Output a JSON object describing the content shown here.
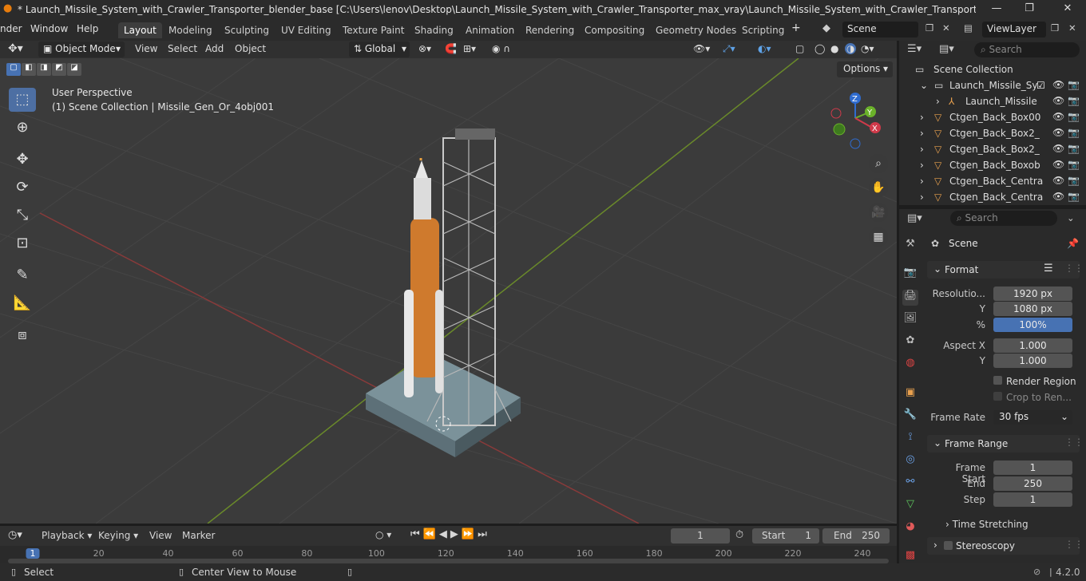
{
  "window": {
    "title": "* Launch_Missile_System_with_Crawler_Transporter_blender_base [C:\\Users\\lenov\\Desktop\\Launch_Missile_System_with_Crawler_Transporter_max_vray\\Launch_Missile_System_with_Crawler_Transporter_blender_base.blend] - ..."
  },
  "menu": [
    "nder",
    "Window",
    "Help"
  ],
  "workspaces": [
    "Layout",
    "Modeling",
    "Sculpting",
    "UV Editing",
    "Texture Paint",
    "Shading",
    "Animation",
    "Rendering",
    "Compositing",
    "Geometry Nodes",
    "Scripting"
  ],
  "scene_field": "Scene",
  "viewlayer_field": "ViewLayer",
  "viewport_header": {
    "mode": "Object Mode",
    "menus": [
      "View",
      "Select",
      "Add",
      "Object"
    ],
    "orientation": "Global",
    "options_label": "Options"
  },
  "viewport": {
    "perspective": "User Perspective",
    "collection_info": "(1) Scene Collection | Missile_Gen_Or_4obj001",
    "gizmo": {
      "x": "X",
      "y": "Y",
      "z": "Z"
    }
  },
  "outliner": {
    "search_placeholder": "Search",
    "root": "Scene Collection",
    "items": [
      {
        "label": "Launch_Missile_Sy"
      },
      {
        "label": "Launch_Missile"
      },
      {
        "label": "Ctgen_Back_Box00"
      },
      {
        "label": "Ctgen_Back_Box2_"
      },
      {
        "label": "Ctgen_Back_Box2_"
      },
      {
        "label": "Ctgen_Back_Boxob"
      },
      {
        "label": "Ctgen_Back_Centra"
      },
      {
        "label": "Ctgen_Back_Centra"
      }
    ]
  },
  "properties": {
    "search_placeholder": "Search",
    "context": "Scene",
    "format_title": "Format",
    "resolution_label": "Resolutio...",
    "resolution_x": "1920 px",
    "y_label": "Y",
    "resolution_y": "1080 px",
    "percent_label": "%",
    "percent": "100%",
    "aspect_label": "Aspect X",
    "aspect_x": "1.000",
    "aspect_y": "1.000",
    "render_region": "Render Region",
    "crop": "Crop to Ren...",
    "frame_rate_label": "Frame Rate",
    "frame_rate": "30 fps",
    "frame_range_title": "Frame Range",
    "frame_start_label": "Frame Start",
    "frame_start": "1",
    "end_label": "End",
    "frame_end": "250",
    "step_label": "Step",
    "step": "1",
    "time_stretching": "Time Stretching",
    "stereoscopy": "Stereoscopy"
  },
  "timeline": {
    "menus": [
      "Playback",
      "Keying",
      "View",
      "Marker"
    ],
    "current_frame": "1",
    "start_label": "Start",
    "start": "1",
    "end_label": "End",
    "end": "250",
    "ruler": [
      "1",
      "20",
      "40",
      "60",
      "80",
      "100",
      "120",
      "140",
      "160",
      "180",
      "200",
      "220",
      "240"
    ]
  },
  "status": {
    "select": "Select",
    "center": "Center View to Mouse",
    "version": "4.2.0"
  }
}
